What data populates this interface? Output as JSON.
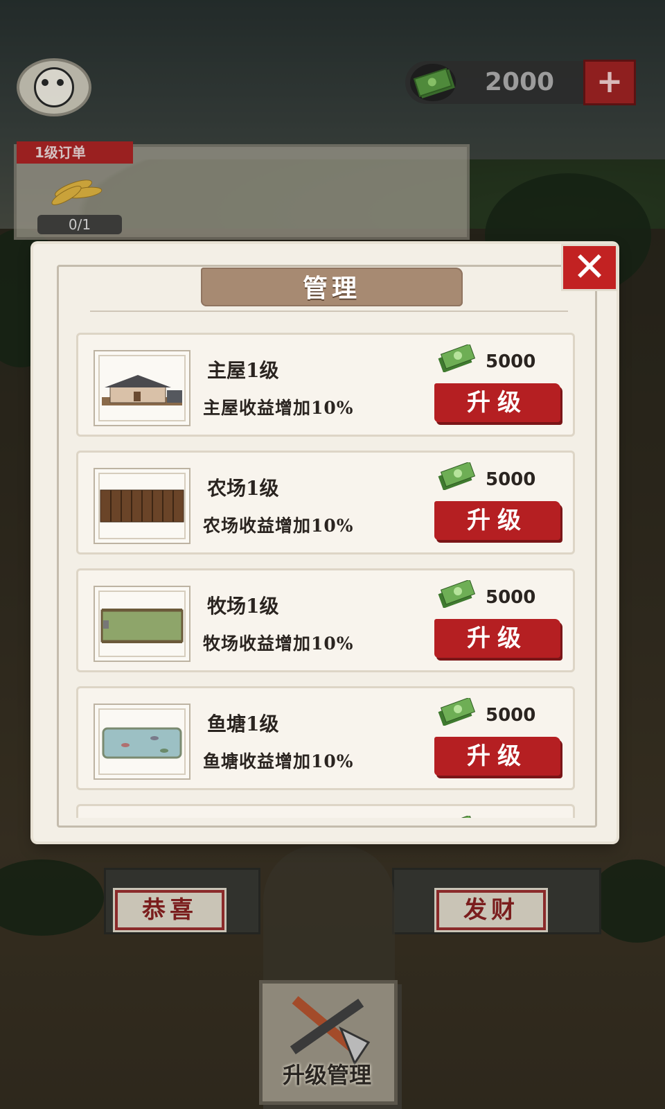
{
  "hud": {
    "money_value": "2000",
    "plus_label": "+"
  },
  "order": {
    "tag": "1级订单",
    "progress": "0/1"
  },
  "signs": {
    "left": "恭喜",
    "right": "发财"
  },
  "bottom": {
    "manage_label": "升级管理"
  },
  "modal": {
    "title": "管理",
    "close_label": "✕",
    "items": [
      {
        "name": "主屋1级",
        "desc": "主屋收益增加10%",
        "cost": "5000",
        "button": "升级",
        "thumb": "house"
      },
      {
        "name": "农场1级",
        "desc": "农场收益增加10%",
        "cost": "5000",
        "button": "升级",
        "thumb": "farm"
      },
      {
        "name": "牧场1级",
        "desc": "牧场收益增加10%",
        "cost": "5000",
        "button": "升级",
        "thumb": "ranch"
      },
      {
        "name": "鱼塘1级",
        "desc": "鱼塘收益增加10%",
        "cost": "5000",
        "button": "升级",
        "thumb": "pond"
      }
    ]
  },
  "colors": {
    "upgrade_red": "#b51f22",
    "close_red": "#c22222",
    "money_green": "#4f8a3b",
    "panel_bg": "#f3efe6",
    "title_banner": "#a78a72"
  }
}
